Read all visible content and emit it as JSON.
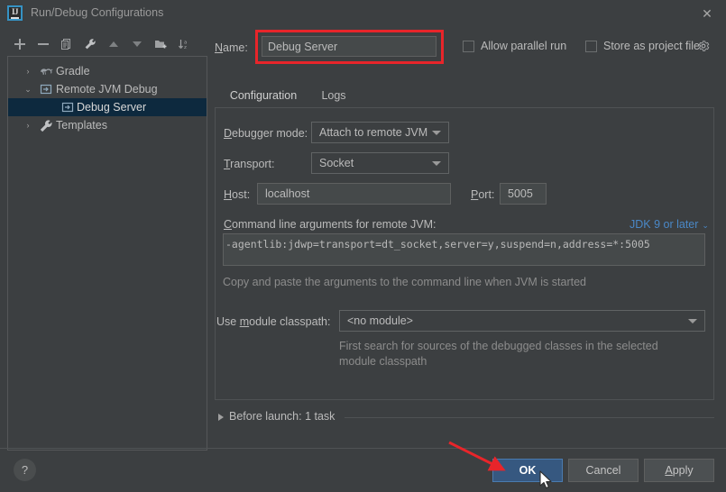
{
  "window": {
    "title": "Run/Debug Configurations",
    "app_icon": "intellij-idea-icon",
    "close_label": "✕"
  },
  "toolbar": {
    "items": [
      {
        "name": "add-configuration-button",
        "icon": "plus-icon",
        "label": "+"
      },
      {
        "name": "remove-configuration-button",
        "icon": "minus-icon",
        "label": "−"
      },
      {
        "name": "copy-configuration-button",
        "icon": "copy-icon",
        "label": "Copy"
      },
      {
        "name": "edit-templates-button",
        "icon": "wrench-icon",
        "label": "Edit Templates"
      },
      {
        "name": "move-up-button",
        "icon": "arrow-up-icon",
        "label": "Move Up"
      },
      {
        "name": "move-down-button",
        "icon": "arrow-down-icon",
        "label": "Move Down"
      },
      {
        "name": "new-folder-button",
        "icon": "folder-add-icon",
        "label": "New Folder"
      },
      {
        "name": "sort-configurations-button",
        "icon": "sort-alpha-icon",
        "label": "Sort Configurations"
      }
    ]
  },
  "tree": {
    "items": [
      {
        "label": "Gradle",
        "icon": "gradle-elephant-icon",
        "twisty": "›",
        "depth": 0,
        "selected": false
      },
      {
        "label": "Remote JVM Debug",
        "icon": "remote-debug-icon",
        "twisty": "⌄",
        "depth": 0,
        "selected": false
      },
      {
        "label": "Debug Server",
        "icon": "remote-debug-icon",
        "twisty": "",
        "depth": 1,
        "selected": true
      },
      {
        "label": "Templates",
        "icon": "wrench-icon",
        "twisty": "›",
        "depth": 0,
        "selected": false
      }
    ]
  },
  "name_row": {
    "label": "Name:",
    "label_mnemonic": "N",
    "value": "Debug Server",
    "highlighted": true,
    "highlight_color": "#e8252a"
  },
  "options": {
    "allow_parallel_run": {
      "label": "Allow parallel run",
      "checked": false
    },
    "store_as_project_file": {
      "label": "Store as project file",
      "checked": false
    },
    "gear_icon": "gear-icon"
  },
  "tabs": [
    {
      "label": "Configuration",
      "active": true
    },
    {
      "label": "Logs",
      "active": false
    }
  ],
  "form": {
    "debugger_mode": {
      "label": "Debugger mode:",
      "value": "Attach to remote JVM"
    },
    "transport": {
      "label": "Transport:",
      "value": "Socket"
    },
    "host": {
      "label": "Host:",
      "value": "localhost"
    },
    "port": {
      "label": "Port:",
      "value": "5005"
    },
    "command_line": {
      "label": "Command line arguments for remote JVM:",
      "jdk_link": "JDK 9 or later",
      "jdk_chevron": "⌄",
      "value": "-agentlib:jdwp=transport=dt_socket,server=y,suspend=n,address=*:5005",
      "hint": "Copy and paste the arguments to the command line when JVM is started"
    },
    "module_classpath": {
      "label": "Use module classpath:",
      "value": "<no module>",
      "hint_line1": "First search for sources of the debugged classes in the selected",
      "hint_line2": "module classpath"
    }
  },
  "before_launch": {
    "label": "Before launch: 1 task",
    "expanded": false
  },
  "footer": {
    "help_label": "?",
    "ok_label": "OK",
    "cancel_label": "Cancel",
    "apply_label": "Apply"
  },
  "annotations": {
    "arrow_color": "#e8252a",
    "arrow_target": "ok-button",
    "cursor": "arrow-pointer"
  },
  "colors": {
    "background": "#3c3f41",
    "field_background": "#45494a",
    "selection": "#0d293e",
    "accent_blue": "#4a88c7",
    "ok_button": "#365880",
    "annotation_red": "#e8252a"
  }
}
